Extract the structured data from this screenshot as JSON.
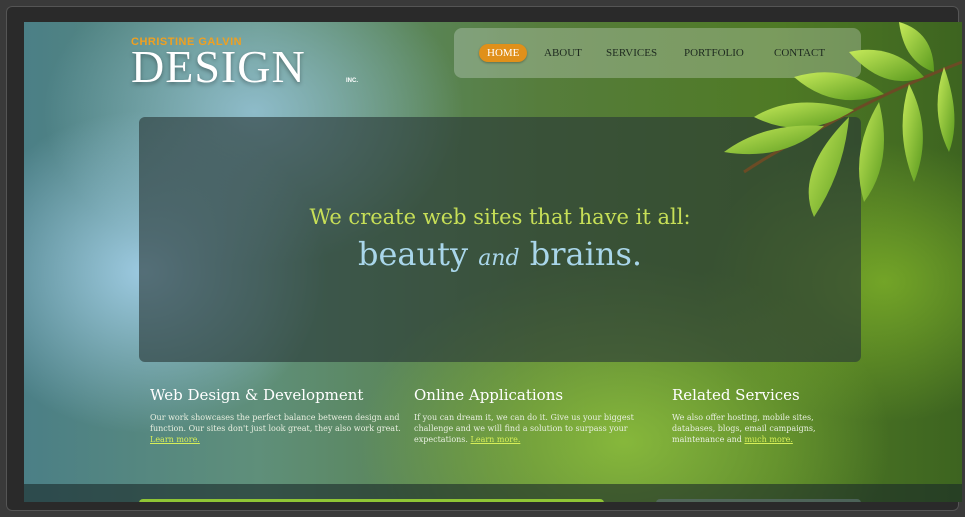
{
  "logo": {
    "top_line": "CHRISTINE GALVIN",
    "main": "DESIGN",
    "inc": "INC."
  },
  "nav": {
    "items": [
      {
        "label": "HOME",
        "active": true
      },
      {
        "label": "ABOUT",
        "active": false
      },
      {
        "label": "SERVICES",
        "active": false
      },
      {
        "label": "PORTFOLIO",
        "active": false
      },
      {
        "label": "CONTACT",
        "active": false
      }
    ]
  },
  "hero": {
    "line1": "We create web sites that have it all:",
    "line2_a": "beauty",
    "line2_em": "and",
    "line2_b": "brains."
  },
  "columns": [
    {
      "title": "Web Design & Development",
      "text": "Our work showcases the perfect balance between design and function. Our sites don't just look great, they also work great.",
      "link": "Learn more."
    },
    {
      "title": "Online Applications",
      "text": "If you can dream it, we can do it. Give us your biggest challenge and we will find a solution to surpass your expectations.",
      "link": "Learn more."
    },
    {
      "title": "Related Services",
      "text": "We also offer hosting, mobile sites, databases, blogs, email campaigns, maintenance and",
      "link": "much more."
    }
  ],
  "colors": {
    "accent_orange": "#e0901a",
    "headline_green": "#c7df57",
    "headline_blue": "#a9d6ea",
    "link_green": "#d7ef58"
  },
  "icons": {
    "decoration": "leaf-branch-icon"
  }
}
